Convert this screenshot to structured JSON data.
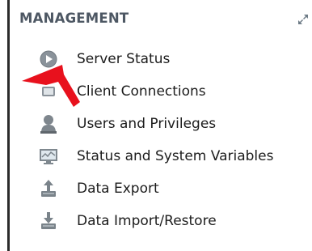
{
  "section": {
    "title": "MANAGEMENT",
    "expand_icon": "expand-icon"
  },
  "items": [
    {
      "label": "Server Status",
      "icon": "server-status-icon"
    },
    {
      "label": "Client Connections",
      "icon": "client-connections-icon"
    },
    {
      "label": "Users and Privileges",
      "icon": "user-icon"
    },
    {
      "label": "Status and System Variables",
      "icon": "monitor-icon"
    },
    {
      "label": "Data Export",
      "icon": "export-icon"
    },
    {
      "label": "Data Import/Restore",
      "icon": "import-icon"
    }
  ],
  "annotation": {
    "pointer_color": "#e8111d"
  },
  "colors": {
    "header_text": "#4d5763",
    "item_text": "#1c1c1c"
  }
}
